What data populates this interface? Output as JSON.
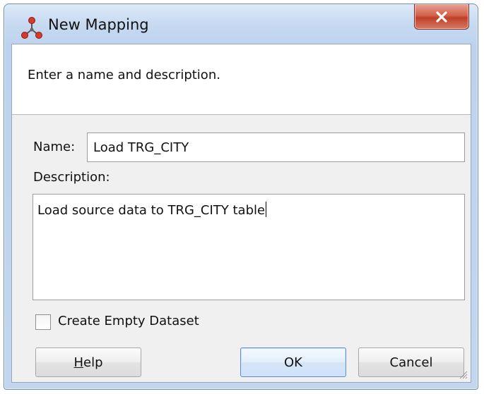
{
  "window": {
    "title": "New Mapping",
    "app_icon": "mapping-icon",
    "close_icon": "close-icon"
  },
  "header": {
    "instruction": "Enter a name and description."
  },
  "form": {
    "name_label": "Name:",
    "name_value": "Load TRG_CITY",
    "description_label": "Description:",
    "description_value": "Load source data to TRG_CITY table",
    "create_empty_dataset_label": "Create Empty Dataset",
    "create_empty_dataset_checked": false
  },
  "buttons": {
    "help_first": "H",
    "help_rest": "elp",
    "ok": "OK",
    "cancel": "Cancel"
  },
  "colors": {
    "close_button": "#c8503a",
    "title_bar": "#c6d9f1",
    "ok_focus_border": "#5d8ec9"
  }
}
